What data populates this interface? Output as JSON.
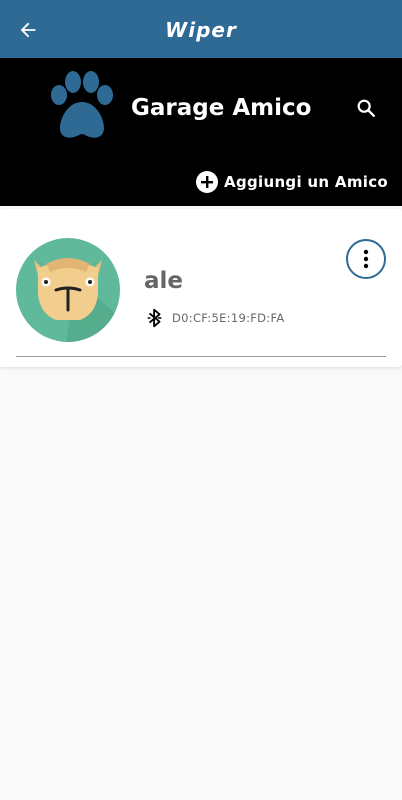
{
  "appbar": {
    "back_icon": "arrow-left-icon",
    "logo_text": "Wiper"
  },
  "header": {
    "logo_icon": "paw-icon",
    "title": "Garage Amico",
    "search_icon": "search-icon",
    "add_friend_label": "Aggiungi un Amico",
    "add_icon": "plus-circle-icon"
  },
  "friends": [
    {
      "name": "ale",
      "avatar_icon": "camel-avatar",
      "bluetooth_icon": "bluetooth-icon",
      "mac_address": "D0:CF:5E:19:FD:FA",
      "menu_icon": "more-vertical-icon"
    }
  ],
  "colors": {
    "appbar": "#2e6a94",
    "header": "#000000",
    "accent": "#2e6a94",
    "avatar_bg": "#5fb99a",
    "background": "#f9f9f9"
  }
}
